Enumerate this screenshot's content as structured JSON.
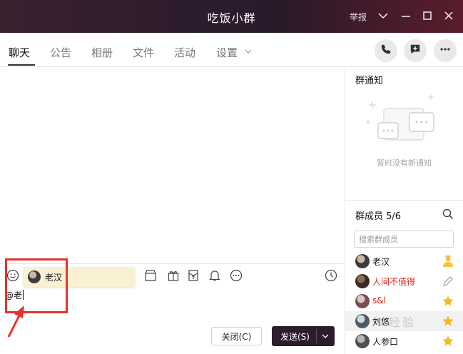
{
  "window": {
    "title": "吃饭小群",
    "report_label": "举报"
  },
  "tabs": [
    {
      "label": "聊天",
      "active": true
    },
    {
      "label": "公告",
      "active": false
    },
    {
      "label": "相册",
      "active": false
    },
    {
      "label": "文件",
      "active": false
    },
    {
      "label": "活动",
      "active": false
    },
    {
      "label": "设置",
      "active": false
    }
  ],
  "header_actions": [
    "phone-icon",
    "add-message-icon",
    "more-icon"
  ],
  "mention_popup": {
    "name": "老汉"
  },
  "input": {
    "text": "@老"
  },
  "buttons": {
    "close_label": "关闭(C)",
    "send_label": "发送(S)"
  },
  "notice": {
    "title": "群通知",
    "empty_text": "暂时没有新通知"
  },
  "members": {
    "title": "群成员 5/6",
    "search_placeholder": "搜索群成员",
    "list": [
      {
        "name": "老汉",
        "color": "#111111",
        "role_icon": "owner-icon"
      },
      {
        "name": "人间不值得",
        "color": "#e0221b",
        "role_icon": "edit-icon"
      },
      {
        "name": "s&l",
        "color": "#e0221b",
        "role_icon": "star-icon"
      },
      {
        "name": "刘悠",
        "color": "#111111",
        "role_icon": "star-icon"
      },
      {
        "name": "人参口",
        "color": "#111111",
        "role_icon": "star-icon"
      }
    ]
  },
  "watermark": "经验"
}
